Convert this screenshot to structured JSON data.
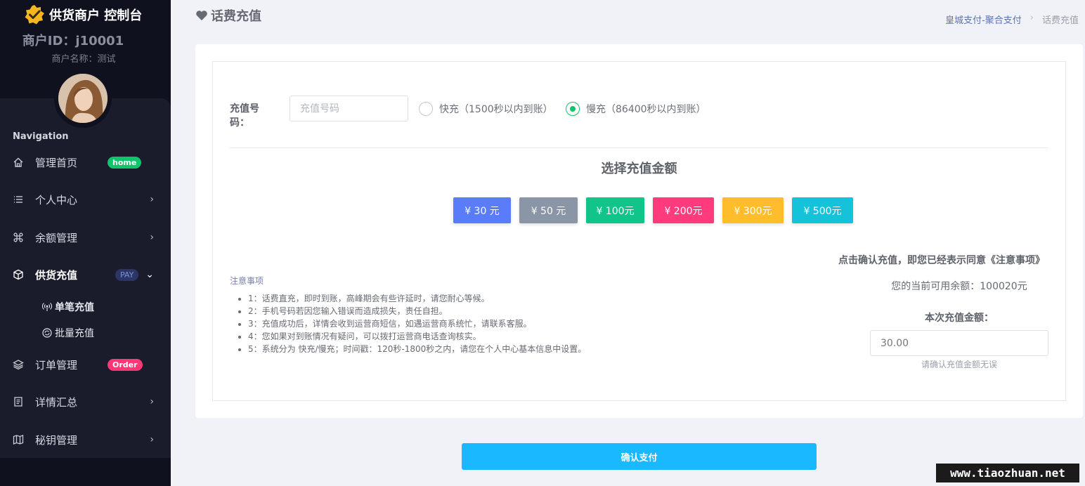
{
  "sidebar": {
    "brand_title": "供货商户 控制台",
    "merchant_id": "商户ID：j10001",
    "merchant_name": "商户名称：测试",
    "nav_label": "Navigation",
    "items": [
      {
        "label": "管理首页",
        "icon": "home-icon",
        "badge": "home"
      },
      {
        "label": "个人中心",
        "icon": "list-icon"
      },
      {
        "label": "余额管理",
        "icon": "command-icon"
      },
      {
        "label": "供货充值",
        "icon": "cube-icon",
        "badge": "PAY"
      },
      {
        "label": "订单管理",
        "icon": "layers-icon",
        "badge": "Order"
      },
      {
        "label": "详情汇总",
        "icon": "document-icon"
      },
      {
        "label": "秘钥管理",
        "icon": "map-icon"
      }
    ],
    "sub_items": [
      {
        "label": "单笔充值",
        "icon": "broadcast-icon"
      },
      {
        "label": "批量充值",
        "icon": "refresh-icon"
      }
    ]
  },
  "header": {
    "title": "话费充值",
    "icon": "heart-icon",
    "breadcrumb": {
      "link": "皇城支付-聚合支付",
      "separator": "›",
      "current": "话费充值"
    }
  },
  "form": {
    "phone_label": "充值号码：",
    "phone_placeholder": "充值号码",
    "radio_fast": "快充（1500秒以内到账）",
    "radio_slow": "慢充（86400秒以内到账）",
    "section_title": "选择充值金额",
    "amounts": [
      {
        "label": "¥ 30 元",
        "color": "#5b7cf8"
      },
      {
        "label": "¥ 50 元",
        "color": "#8a95a6"
      },
      {
        "label": "¥ 100元",
        "color": "#10c48a"
      },
      {
        "label": "¥ 200元",
        "color": "#ff3a7d"
      },
      {
        "label": "¥ 300元",
        "color": "#ffbc2b"
      },
      {
        "label": "¥ 500元",
        "color": "#14c3d9"
      }
    ],
    "notes_title": "注意事项",
    "notes": [
      "1：话费直充，即时到账，高峰期会有些许延时，请您耐心等候。",
      "2：手机号码若因您输入错误而造成损失，责任自担。",
      "3：充值成功后，详情会收到运营商短信，如遇运营商系统忙，请联系客服。",
      "4：您如果对到账情况有疑问，可以拨打运营商电话查询核实。",
      "5：系统分为 快充/慢充；时间戳：120秒-1800秒之内，请您在个人中心基本信息中设置。"
    ],
    "agree_text": "点击确认充值，即您已经表示同意《注意事项》",
    "balance_text": "您的当前可用余额：100020元",
    "amount_label": "本次充值金额：",
    "amount_value": "30.00",
    "amount_hint": "请确认充值金额无误",
    "pay_button": "确认支付"
  },
  "watermark": "www.tiaozhuan.net",
  "colors": {
    "sidebar": "#10111f",
    "accent": "#1ab8ff",
    "success": "#10c469"
  }
}
